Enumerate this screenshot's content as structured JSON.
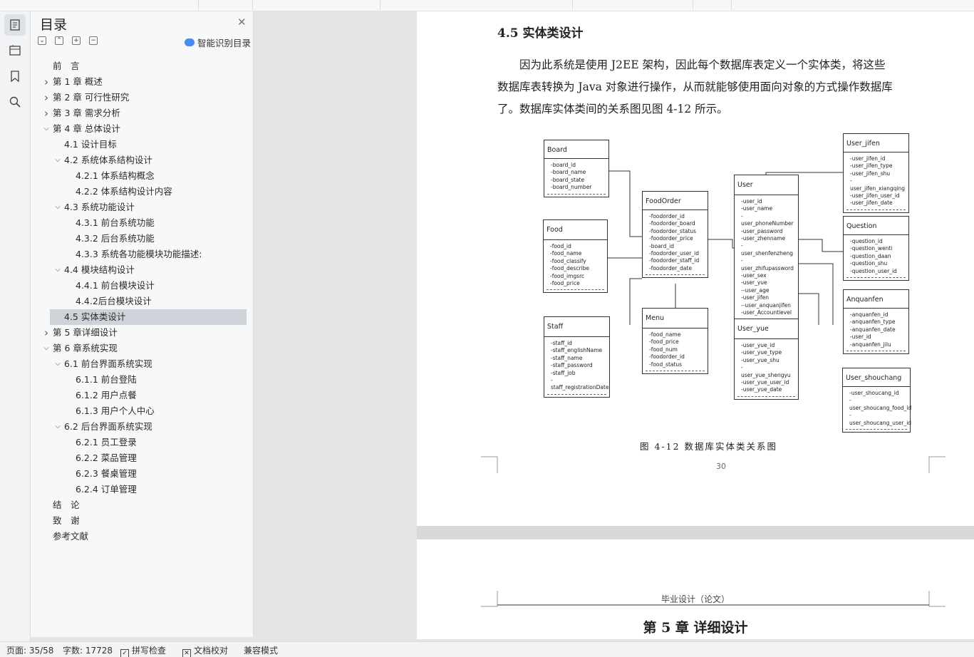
{
  "toc": {
    "title": "目录",
    "smart_label": "智能识别目录",
    "items": [
      {
        "label": "前　言",
        "level": 0,
        "arrow": ""
      },
      {
        "label": "第 1 章  概述",
        "level": 0,
        "arrow": "right"
      },
      {
        "label": "第 2 章  可行性研究",
        "level": 0,
        "arrow": "right"
      },
      {
        "label": "第 3 章  需求分析",
        "level": 0,
        "arrow": "right"
      },
      {
        "label": "第 4 章  总体设计",
        "level": 0,
        "arrow": "down"
      },
      {
        "label": "4.1  设计目标",
        "level": 1,
        "arrow": ""
      },
      {
        "label": "4.2  系统体系结构设计",
        "level": 1,
        "arrow": "down"
      },
      {
        "label": "4.2.1  体系结构概念",
        "level": 2,
        "arrow": ""
      },
      {
        "label": "4.2.2  体系结构设计内容",
        "level": 2,
        "arrow": ""
      },
      {
        "label": "4.3  系统功能设计",
        "level": 1,
        "arrow": "down"
      },
      {
        "label": "4.3.1  前台系统功能",
        "level": 2,
        "arrow": ""
      },
      {
        "label": "4.3.2  后台系统功能",
        "level": 2,
        "arrow": ""
      },
      {
        "label": "4.3.3  系统各功能模块功能描述:",
        "level": 2,
        "arrow": ""
      },
      {
        "label": "4.4  模块结构设计",
        "level": 1,
        "arrow": "down"
      },
      {
        "label": "4.4.1  前台模块设计",
        "level": 2,
        "arrow": ""
      },
      {
        "label": "4.4.2后台模块设计",
        "level": 2,
        "arrow": ""
      },
      {
        "label": "4.5  实体类设计",
        "level": 1,
        "arrow": "",
        "selected": true
      },
      {
        "label": "第 5 章详细设计",
        "level": 0,
        "arrow": "right"
      },
      {
        "label": "第 6 章系统实现",
        "level": 0,
        "arrow": "down"
      },
      {
        "label": "6.1  前台界面系统实现",
        "level": 1,
        "arrow": "down"
      },
      {
        "label": "6.1.1  前台登陆",
        "level": 2,
        "arrow": ""
      },
      {
        "label": "6.1.2  用户点餐",
        "level": 2,
        "arrow": ""
      },
      {
        "label": "6.1.3  用户个人中心",
        "level": 2,
        "arrow": ""
      },
      {
        "label": "6.2  后台界面系统实现",
        "level": 1,
        "arrow": "down"
      },
      {
        "label": "6.2.1  员工登录",
        "level": 2,
        "arrow": ""
      },
      {
        "label": "6.2.2  菜品管理",
        "level": 2,
        "arrow": ""
      },
      {
        "label": "6.2.3  餐桌管理",
        "level": 2,
        "arrow": ""
      },
      {
        "label": "6.2.4  订单管理",
        "level": 2,
        "arrow": ""
      },
      {
        "label": "结　论",
        "level": 0,
        "arrow": ""
      },
      {
        "label": "致　谢",
        "level": 0,
        "arrow": ""
      },
      {
        "label": "参考文献",
        "level": 0,
        "arrow": ""
      }
    ]
  },
  "doc": {
    "section_title": "4.5  实体类设计",
    "para_lines": [
      "　　因为此系统是使用 J2EE 架构，因此每个数据库表定义一个实体类，将这些",
      "数据库表转换为 Java 对象进行操作，从而就能够使用面向对象的方式操作数据库",
      "了。数据库实体类间的关系图见图 4-12 所示。"
    ],
    "caption": "图 4-12  数据库实体类关系图",
    "page_number": "30",
    "next_header": "毕业设计（论文）",
    "next_chapter": "第 5 章  详细设计"
  },
  "diagram": {
    "Board": [
      "-board_id",
      "-board_name",
      "-board_state",
      "-board_number"
    ],
    "Food": [
      "-food_id",
      "-food_name",
      "-food_classify",
      "-food_describe",
      "-food_imgsrc",
      "-food_price"
    ],
    "Staff": [
      "-staff_id",
      "-staff_englishName",
      "-staff_name",
      "-staff_password",
      "-staff_job",
      "-staff_registrationDate"
    ],
    "FoodOrder": [
      "-foodorder_id",
      "-foodorder_board",
      "-foodorder_status",
      "-foodorder_price",
      "-board_id",
      "-foodorder_user_id",
      "-foodorder_staff_id",
      "-foodorder_date"
    ],
    "Menu": [
      "-food_name",
      "-food_price",
      "-food_num",
      "-foodorder_id",
      "-food_status"
    ],
    "User": [
      "-user_id",
      "-user_name",
      "-user_phoneNumber",
      "-user_password",
      "-user_zhenname",
      "-user_shenfenzheng",
      "-user_zhifupassword",
      "-user_sex",
      "-user_yue",
      "--user_age",
      "-user_jifen",
      "--user_anquanjifen",
      "-user_Accountlevel"
    ],
    "User_yue": [
      "-user_yue_id",
      "-user_yue_type",
      "-user_yue_shu",
      "-user_yue_shengyu",
      "-user_yue_user_id",
      "-user_yue_date"
    ],
    "User_jifen": [
      "-user_jifen_id",
      "-user_jifen_type",
      "-user_jifen_shu",
      "-user_jifen_xiangqing",
      "-user_jifen_user_id",
      "-user_jifen_date"
    ],
    "Question": [
      "-question_id",
      "-question_wenti",
      "-question_daan",
      "-question_shu",
      "-question_user_id"
    ],
    "Anquanfen": [
      "-anquanfen_id",
      "-anquanfen_type",
      "-anquanfen_date",
      "-user_id",
      "-anquanfen_jilu"
    ],
    "User_shouchang": [
      "-user_shoucang_id",
      "-user_shoucang_food_id",
      "-user_shoucang_user_id"
    ]
  },
  "status": {
    "page": "页面: 35/58",
    "words": "字数: 17728",
    "spell": "拼写检查",
    "proof": "文档校对",
    "compat": "兼容模式"
  }
}
